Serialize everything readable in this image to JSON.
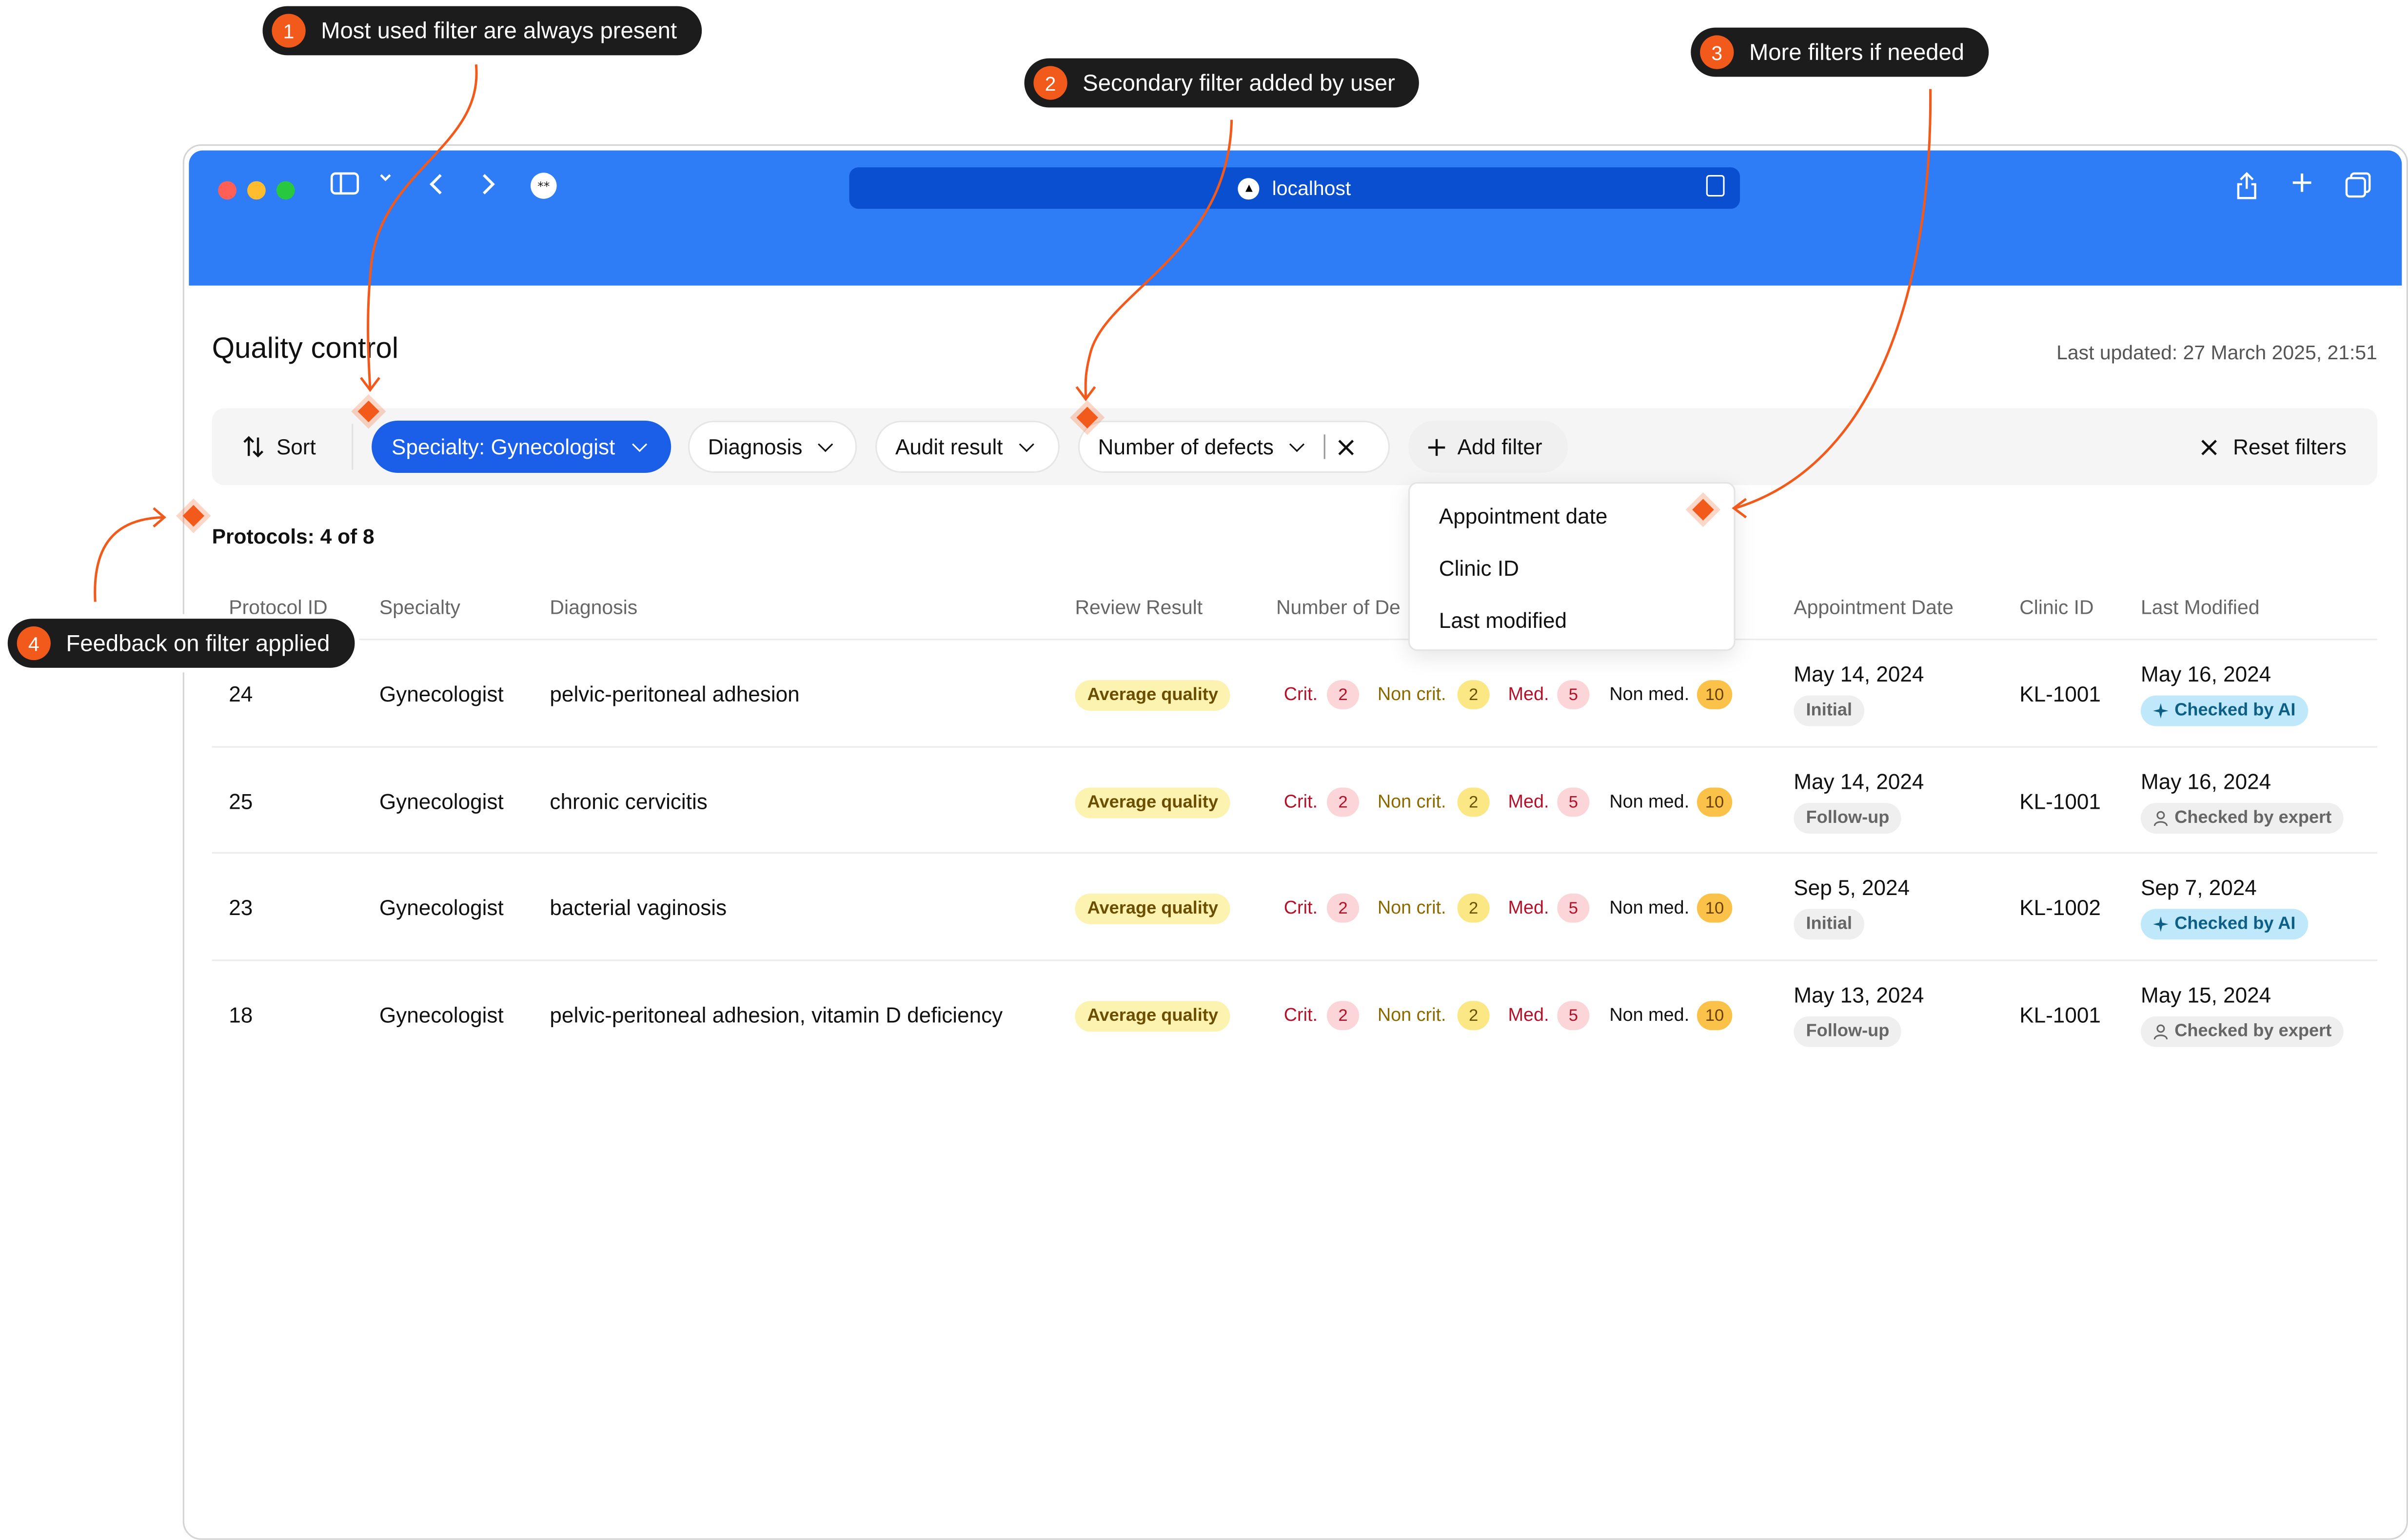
{
  "annotations": [
    {
      "num": "1",
      "text": "Most used filter are always present"
    },
    {
      "num": "2",
      "text": "Secondary filter added by user"
    },
    {
      "num": "3",
      "text": "More filters if needed"
    },
    {
      "num": "4",
      "text": "Feedback on filter applied"
    }
  ],
  "browser": {
    "url": "localhost",
    "chrome_color": "#2e7cf6",
    "icons": [
      "sidebar-icon",
      "chevron-down-icon",
      "back-icon",
      "forward-icon",
      "extension-icon",
      "share-icon",
      "new-tab-icon",
      "tabs-overview-icon",
      "reader-icon"
    ]
  },
  "page": {
    "title": "Quality control",
    "last_updated": "Last updated: 27 March 2025, 21:51",
    "protocols_count": "Protocols: 4 of 8"
  },
  "filters": {
    "sort_label": "Sort",
    "specialty_chip": "Specialty: Gynecologist",
    "diagnosis_chip": "Diagnosis",
    "audit_chip": "Audit result",
    "defects_chip": "Number of defects",
    "add_filter": "Add filter",
    "reset": "Reset filters",
    "active_color": "#1b5fe8"
  },
  "add_filter_menu": [
    "Appointment date",
    "Clinic ID",
    "Last modified"
  ],
  "table": {
    "columns": [
      "Protocol ID",
      "Specialty",
      "Diagnosis",
      "Review Result",
      "Number of De",
      "Appointment Date",
      "Clinic ID",
      "Last Modified"
    ],
    "defect_labels": {
      "crit": "Crit.",
      "noncrit": "Non crit.",
      "med": "Med.",
      "nonmed": "Non med."
    },
    "rows": [
      {
        "id": "24",
        "specialty": "Gynecologist",
        "diagnosis": "pelvic-peritoneal adhesion",
        "review": "Average quality",
        "crit": "2",
        "noncrit": "2",
        "med": "5",
        "nonmed": "10",
        "appt_date": "May 14, 2024",
        "appt_type": "Initial",
        "clinic": "KL-1001",
        "modified": "May 16, 2024",
        "checked": "Checked by AI"
      },
      {
        "id": "25",
        "specialty": "Gynecologist",
        "diagnosis": "chronic cervicitis",
        "review": "Average quality",
        "crit": "2",
        "noncrit": "2",
        "med": "5",
        "nonmed": "10",
        "appt_date": "May 14, 2024",
        "appt_type": "Follow-up",
        "clinic": "KL-1001",
        "modified": "May 16, 2024",
        "checked": "Checked by expert"
      },
      {
        "id": "23",
        "specialty": "Gynecologist",
        "diagnosis": "bacterial vaginosis",
        "review": "Average quality",
        "crit": "2",
        "noncrit": "2",
        "med": "5",
        "nonmed": "10",
        "appt_date": "Sep 5, 2024",
        "appt_type": "Initial",
        "clinic": "KL-1002",
        "modified": "Sep 7, 2024",
        "checked": "Checked by AI"
      },
      {
        "id": "18",
        "specialty": "Gynecologist",
        "diagnosis": "pelvic-peritoneal adhesion, vitamin D deficiency",
        "review": "Average quality",
        "crit": "2",
        "noncrit": "2",
        "med": "5",
        "nonmed": "10",
        "appt_date": "May 13, 2024",
        "appt_type": "Follow-up",
        "clinic": "KL-1001",
        "modified": "May 15, 2024",
        "checked": "Checked by expert"
      }
    ]
  },
  "colors": {
    "accent_orange": "#f25a1c",
    "ai_badge": "#bfe9fb",
    "review_badge": "#fdf3b0"
  }
}
